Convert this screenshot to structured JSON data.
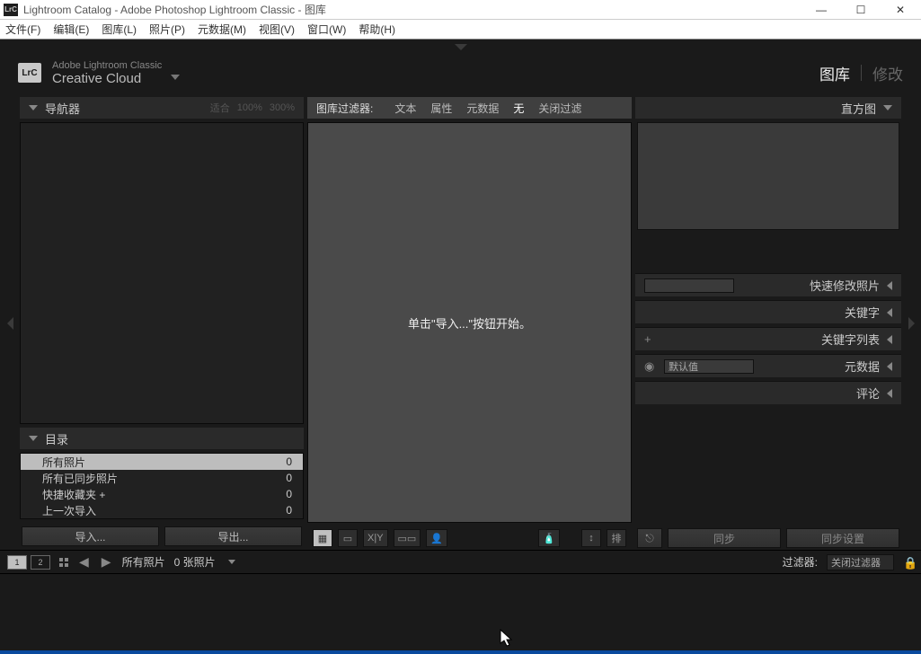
{
  "window": {
    "title": "Lightroom Catalog - Adobe Photoshop Lightroom Classic - 图库",
    "app_icon": "LrC"
  },
  "menus": [
    "文件(F)",
    "编辑(E)",
    "图库(L)",
    "照片(P)",
    "元数据(M)",
    "视图(V)",
    "窗口(W)",
    "帮助(H)"
  ],
  "brand": {
    "icon": "LrC",
    "line1": "Adobe Lightroom Classic",
    "line2": "Creative Cloud"
  },
  "modules": {
    "active": "图库",
    "inactive": "修改"
  },
  "left": {
    "navigator": {
      "title": "导航器",
      "fit": "适合",
      "z100": "100%",
      "z300": "300%"
    },
    "catalog": {
      "title": "目录",
      "rows": [
        {
          "label": "所有照片",
          "count": "0",
          "selected": true
        },
        {
          "label": "所有已同步照片",
          "count": "0",
          "selected": false
        },
        {
          "label": "快捷收藏夹 +",
          "count": "0",
          "selected": false
        },
        {
          "label": "上一次导入",
          "count": "0",
          "selected": false
        }
      ]
    },
    "import_btn": "导入...",
    "export_btn": "导出..."
  },
  "center": {
    "filter_label": "图库过滤器:",
    "filters": [
      "文本",
      "属性",
      "元数据",
      "无",
      "关闭过滤"
    ],
    "active_filter": "无",
    "empty_msg": "单击\"导入...\"按钮开始。",
    "toolbar": {
      "grid": "▦",
      "loupe": "▭",
      "xy": "X|Y",
      "compare": "▭▭",
      "people": "👤",
      "spray": "🧴",
      "sort": "↕",
      "sort_label": "排"
    }
  },
  "right": {
    "histogram_title": "直方图",
    "panels": [
      {
        "id": "quick-develop",
        "label": "快速修改照片",
        "icon": "select"
      },
      {
        "id": "keywording",
        "label": "关键字",
        "icon": ""
      },
      {
        "id": "keyword-list",
        "label": "关键字列表",
        "icon": "plus"
      },
      {
        "id": "metadata",
        "label": "元数据",
        "icon": "eye",
        "preset": "默认值"
      },
      {
        "id": "comments",
        "label": "评论",
        "icon": ""
      }
    ],
    "sync": {
      "sync_btn": "同步",
      "sync_settings": "同步设置"
    }
  },
  "status": {
    "source": "所有照片",
    "count_label": "0 张照片",
    "filter_label": "过滤器:",
    "filter_value": "关闭过滤器"
  }
}
